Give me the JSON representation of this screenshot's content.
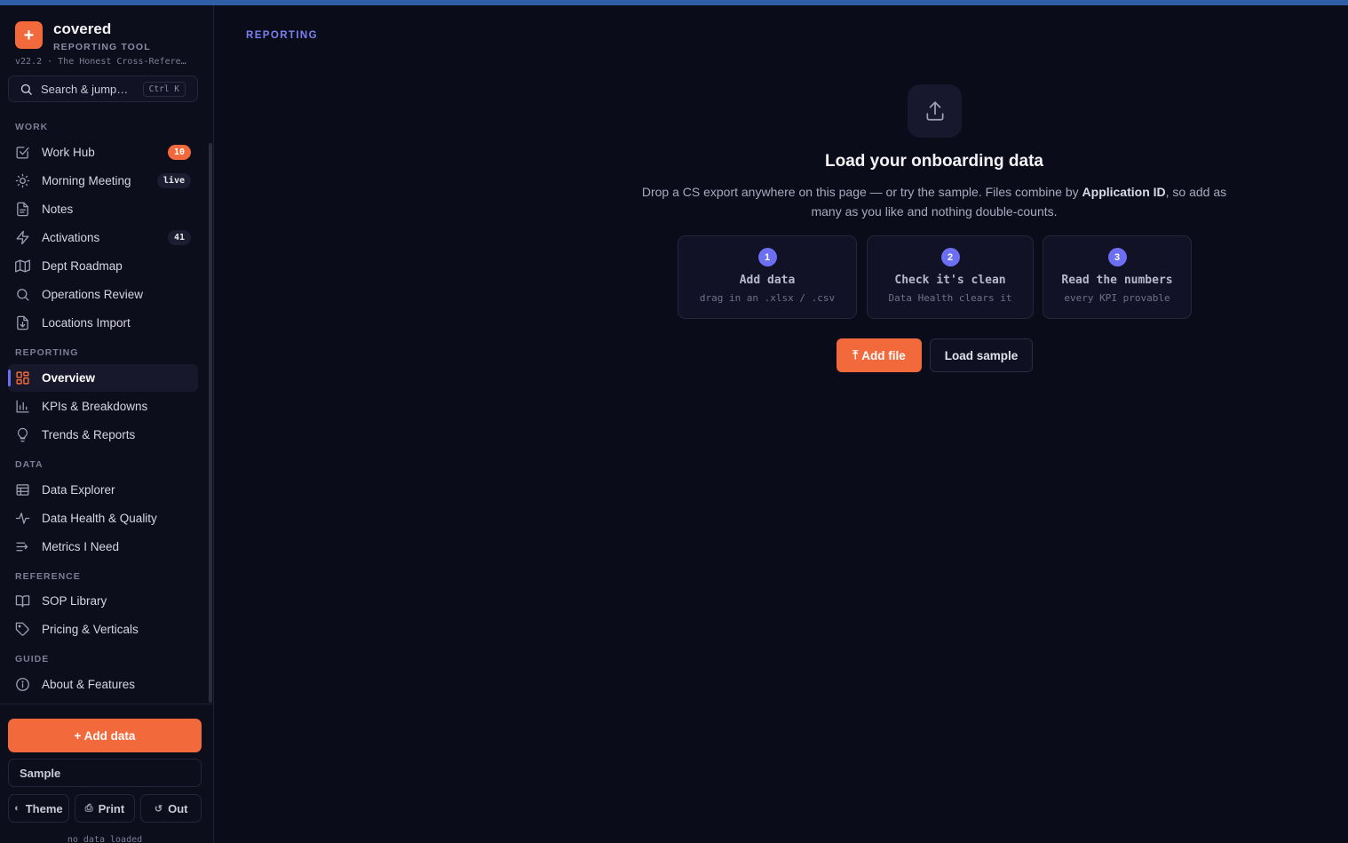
{
  "brand": {
    "logo_glyph": "+",
    "name": "covered",
    "subtitle": "REPORTING TOOL",
    "version": "v22.2 · The Honest Cross-Refere…"
  },
  "search": {
    "placeholder": "Search & jump…",
    "shortcut": "Ctrl K"
  },
  "sidebar": {
    "sections": {
      "work": "WORK",
      "reporting": "REPORTING",
      "data": "DATA",
      "reference": "REFERENCE",
      "guide": "GUIDE"
    },
    "items": {
      "work_hub": {
        "label": "Work Hub",
        "badge": "10",
        "icon": "checkbox-icon"
      },
      "morning_meeting": {
        "label": "Morning Meeting",
        "badge": "live",
        "icon": "sun-icon"
      },
      "notes": {
        "label": "Notes",
        "icon": "document-icon"
      },
      "activations": {
        "label": "Activations",
        "badge": "41",
        "icon": "bolt-icon"
      },
      "dept_roadmap": {
        "label": "Dept Roadmap",
        "icon": "map-icon"
      },
      "operations_review": {
        "label": "Operations Review",
        "icon": "search-icon"
      },
      "locations_import": {
        "label": "Locations Import",
        "icon": "file-download-icon"
      },
      "overview": {
        "label": "Overview",
        "icon": "grid-icon",
        "active": true
      },
      "kpis": {
        "label": "KPIs & Breakdowns",
        "icon": "bar-chart-icon"
      },
      "trends": {
        "label": "Trends & Reports",
        "icon": "lightbulb-icon"
      },
      "data_explorer": {
        "label": "Data Explorer",
        "icon": "table-icon"
      },
      "data_health": {
        "label": "Data Health & Quality",
        "icon": "pulse-icon"
      },
      "metrics": {
        "label": "Metrics I Need",
        "icon": "list-arrow-icon"
      },
      "sop_library": {
        "label": "SOP Library",
        "icon": "book-icon"
      },
      "pricing": {
        "label": "Pricing & Verticals",
        "icon": "tag-icon"
      },
      "about": {
        "label": "About & Features",
        "icon": "info-icon"
      }
    }
  },
  "footer": {
    "add_data": "+ Add data",
    "sample": "Sample",
    "theme": "Theme",
    "print": "Print",
    "out": "Out",
    "status": "no data loaded"
  },
  "main": {
    "breadcrumb": "REPORTING",
    "title": "Load your onboarding data",
    "desc_before": "Drop a CS export anywhere on this page — or try the sample. Files combine by ",
    "desc_bold": "Application ID",
    "desc_after": ", so add as many as you like and nothing double-counts.",
    "steps": [
      {
        "num": "1",
        "title": "Add data",
        "sub": "drag in an .xlsx / .csv"
      },
      {
        "num": "2",
        "title": "Check it's clean",
        "sub": "Data Health clears it"
      },
      {
        "num": "3",
        "title": "Read the numbers",
        "sub": "every KPI provable"
      }
    ],
    "add_file": "Add file",
    "load_sample": "Load sample"
  },
  "colors": {
    "accent_orange": "#f26a3b",
    "accent_purple": "#6c6ff2",
    "background": "#0b0c1a",
    "top_bar": "#2f5ea6"
  }
}
